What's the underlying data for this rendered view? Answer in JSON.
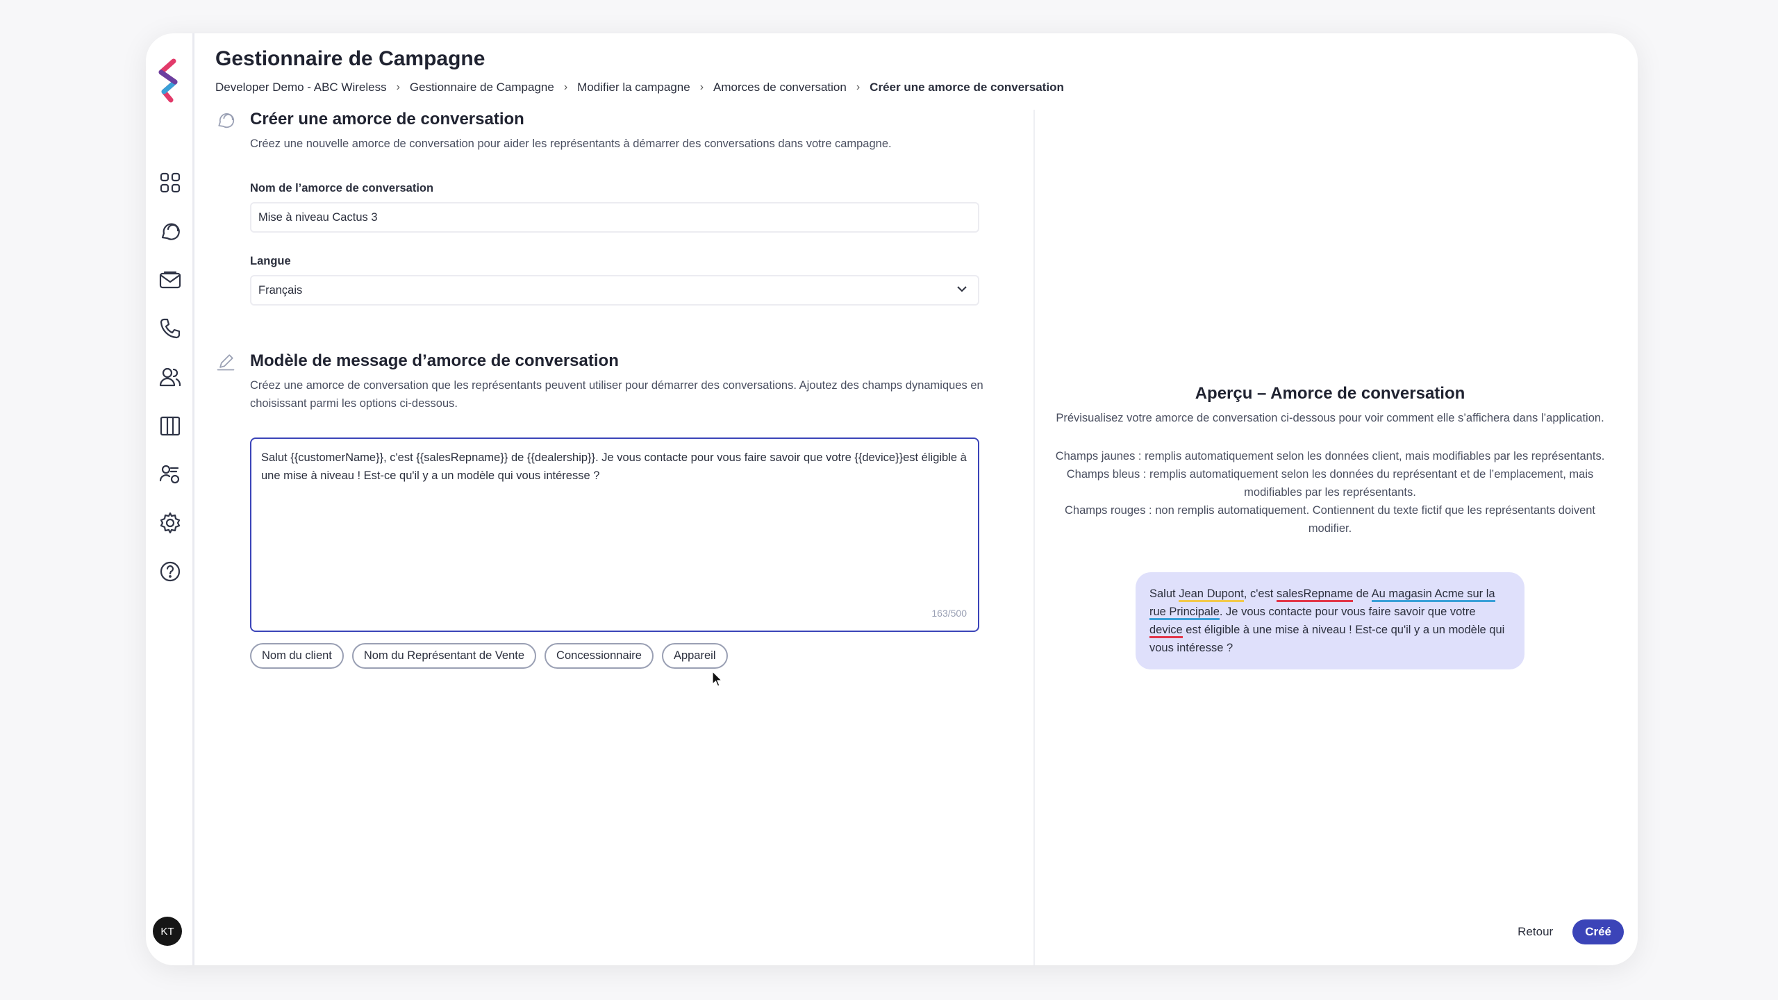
{
  "header": {
    "title": "Gestionnaire de Campagne",
    "breadcrumb": [
      "Developer Demo - ABC Wireless",
      "Gestionnaire de Campagne",
      "Modifier la campagne",
      "Amorces de conversation",
      "Créer une amorce de conversation"
    ]
  },
  "sidebar": {
    "avatar_initials": "KT",
    "icons": [
      "dashboard-icon",
      "chat-icon",
      "inbox-icon",
      "phone-icon",
      "users-icon",
      "library-icon",
      "user-admin-icon",
      "settings-icon",
      "help-icon"
    ]
  },
  "create_section": {
    "title": "Créer une amorce de conversation",
    "description": "Créez une nouvelle amorce de conversation pour aider les représentants à démarrer des conversations dans votre campagne.",
    "name_label": "Nom de l’amorce de conversation",
    "name_value": "Mise à niveau Cactus 3",
    "language_label": "Langue",
    "language_value": "Français"
  },
  "template_section": {
    "title": "Modèle de message d’amorce de conversation",
    "description": "Créez une amorce de conversation que les représentants peuvent utiliser pour démarrer des conversations. Ajoutez des champs dynamiques en choisissant parmi les options ci-dessous.",
    "message": "Salut {{customerName}}, c'est {{salesRepname}} de {{dealership}}. Je vous contacte pour vous faire savoir que votre {{device}}est éligible à une mise à niveau ! Est-ce qu'il y a un modèle qui vous intéresse ?",
    "char_count": "163/500",
    "chips": [
      "Nom du client",
      "Nom du Représentant de Vente",
      "Concessionnaire",
      "Appareil"
    ]
  },
  "preview": {
    "title": "Aperçu – Amorce de conversation",
    "subtitle": "Prévisualisez votre amorce de conversation ci-dessous pour voir comment elle s’affichera dans l’application.",
    "legend_yellow": "Champs jaunes : remplis automatiquement selon les données client, mais modifiables par les représentants.",
    "legend_blue": "Champs bleus : remplis automatiquement selon les données du représentant et de l’emplacement, mais modifiables par les représentants.",
    "legend_red": "Champs rouges : non remplis automatiquement. Contiennent du texte fictif que les représentants doivent modifier.",
    "bubble": {
      "p1": "Salut ",
      "customer": "Jean Dupont",
      "p2": ", c'est ",
      "rep": "salesRepname",
      "p3": " de ",
      "dealership": "Au magasin Acme sur la rue Principale",
      "p4": ". Je vous contacte pour vous faire savoir que votre ",
      "device": "device",
      "p5": "  est éligible à une mise à niveau ! Est-ce qu'il y a un modèle qui vous intéresse ?"
    }
  },
  "footer": {
    "back_label": "Retour",
    "create_label": "Créé"
  },
  "colors": {
    "accent": "#3b44b8",
    "bubble_bg": "#dfe0fb",
    "yellow": "#f2c94c",
    "blue": "#3aa0d8",
    "red": "#e2364a"
  }
}
